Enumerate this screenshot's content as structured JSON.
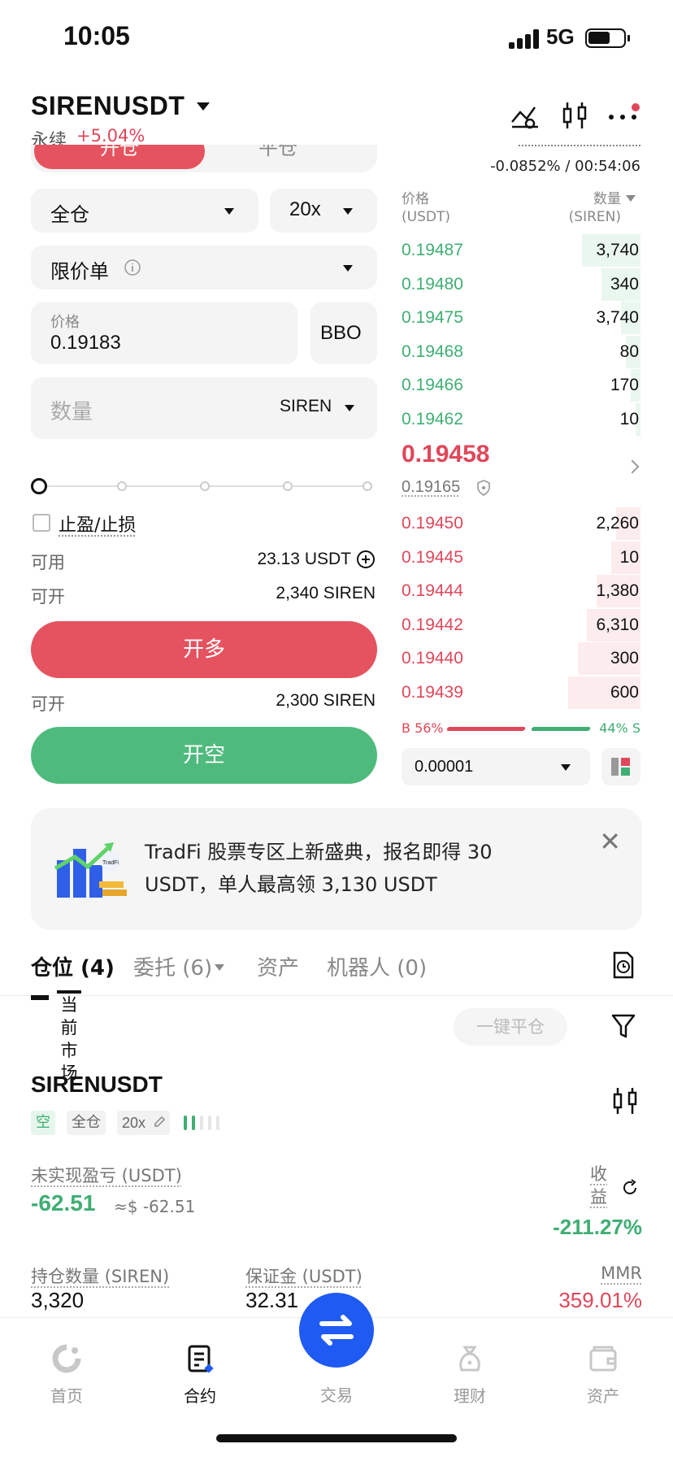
{
  "status_bar": {
    "time": "10:05",
    "network": "5G"
  },
  "header": {
    "pair": "SIRENUSDT",
    "perp_label": "永续",
    "change": "+5.04%",
    "funding": "-0.0852% / 00:54:06"
  },
  "order_panel": {
    "tab_open": "开仓",
    "tab_close": "平仓",
    "margin_mode": "全仓",
    "leverage": "20x",
    "order_type": "限价单",
    "price_label": "价格",
    "price_value": "0.19183",
    "bbo_label": "BBO",
    "qty_placeholder": "数量",
    "qty_unit": "SIREN",
    "tpsl_label": "止盈/止损",
    "available_label": "可用",
    "available_value": "23.13 USDT",
    "can_open_label": "可开",
    "can_open_long": "2,340 SIREN",
    "long_button": "开多",
    "can_open_short": "2,300 SIREN",
    "short_button": "开空"
  },
  "order_book": {
    "price_header": "价格",
    "price_unit": "(USDT)",
    "qty_header": "数量",
    "qty_unit": "(SIREN)",
    "asks": [
      {
        "price": "0.19487",
        "qty": "3,740",
        "depth": 0.24
      },
      {
        "price": "0.19480",
        "qty": "340",
        "depth": 0.16
      },
      {
        "price": "0.19475",
        "qty": "3,740",
        "depth": 0.08
      },
      {
        "price": "0.19468",
        "qty": "80",
        "depth": 0.06
      },
      {
        "price": "0.19466",
        "qty": "170",
        "depth": 0.04
      },
      {
        "price": "0.19462",
        "qty": "10",
        "depth": 0.02
      }
    ],
    "last_price": "0.19458",
    "mark_price": "0.19165",
    "bids": [
      {
        "price": "0.19450",
        "qty": "2,260",
        "depth": 0.1
      },
      {
        "price": "0.19445",
        "qty": "10",
        "depth": 0.12
      },
      {
        "price": "0.19444",
        "qty": "1,380",
        "depth": 0.18
      },
      {
        "price": "0.19442",
        "qty": "6,310",
        "depth": 0.22
      },
      {
        "price": "0.19440",
        "qty": "300",
        "depth": 0.26
      },
      {
        "price": "0.19439",
        "qty": "600",
        "depth": 0.3
      }
    ],
    "buy_ratio": "B 56%",
    "sell_ratio": "44% S",
    "tick_size": "0.00001"
  },
  "banner": {
    "text": "TradFi 股票专区上新盛典，报名即得 30 USDT，单人最高领 3,130 USDT",
    "image_label": "TradFi"
  },
  "positions_tabs": {
    "positions": "仓位 (4)",
    "orders": "委托 (6)",
    "assets": "资产",
    "bots": "机器人 (0)"
  },
  "position": {
    "current_market": "当前市场",
    "close_all": "一键平仓",
    "symbol": "SIRENUSDT",
    "side": "空",
    "mode": "全仓",
    "leverage": "20x",
    "unrealized_label": "未实现盈亏 (USDT)",
    "unrealized_value": "-62.51",
    "unrealized_approx": "≈$ -62.51",
    "roe_label": "收益",
    "roe_value": "-211.27%",
    "size_label": "持仓数量 (SIREN)",
    "size_value": "3,320",
    "margin_label": "保证金 (USDT)",
    "margin_value": "32.31",
    "mmr_label": "MMR",
    "mmr_value": "359.01%"
  },
  "bottom_nav": {
    "home": "首页",
    "futures": "合约",
    "trade": "交易",
    "earn": "理财",
    "assets": "资产"
  },
  "colors": {
    "red": "#e0475a",
    "green": "#3fae73",
    "blue": "#1f5af3"
  }
}
